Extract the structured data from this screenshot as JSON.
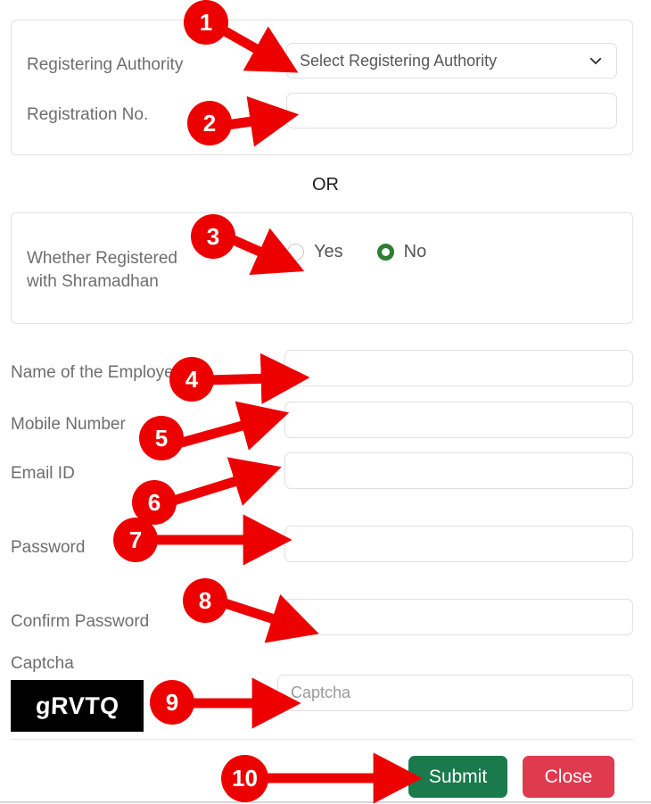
{
  "form": {
    "registration_panel": {
      "registering_authority_label": "Registering Authority",
      "registering_authority_value": "Select Registering Authority",
      "registering_authority_icon": "chevron-down-icon",
      "registration_no_label": "Registration No.",
      "registration_no_value": ""
    },
    "separator_text": "OR",
    "shramadhan_panel": {
      "label": "Whether Registered\nwith Shramadhan",
      "options": [
        {
          "label": "Yes",
          "selected": false
        },
        {
          "label": "No",
          "selected": true
        }
      ],
      "selected_color": "#2e7d32"
    },
    "fields": [
      {
        "label": "Name of the Employer",
        "value": "",
        "placeholder": ""
      },
      {
        "label": "Mobile Number",
        "value": "",
        "placeholder": ""
      },
      {
        "label": "Email ID",
        "value": "",
        "placeholder": ""
      },
      {
        "label": "Password",
        "value": "",
        "placeholder": ""
      },
      {
        "label": "Confirm Password",
        "value": "",
        "placeholder": ""
      }
    ],
    "captcha": {
      "label": "Captcha",
      "image_text": "gRVTQ",
      "refresh_icon": "refresh-icon",
      "input_value": "",
      "input_placeholder": "Captcha"
    },
    "footer": {
      "submit_label": "Submit",
      "submit_color": "#1a7a4c",
      "close_label": "Close",
      "close_color": "#e03a4e"
    }
  },
  "annotations": {
    "color": "#ec0000",
    "markers": [
      {
        "number": "1"
      },
      {
        "number": "2"
      },
      {
        "number": "3"
      },
      {
        "number": "4"
      },
      {
        "number": "5"
      },
      {
        "number": "6"
      },
      {
        "number": "7"
      },
      {
        "number": "8"
      },
      {
        "number": "9"
      },
      {
        "number": "10"
      }
    ]
  }
}
